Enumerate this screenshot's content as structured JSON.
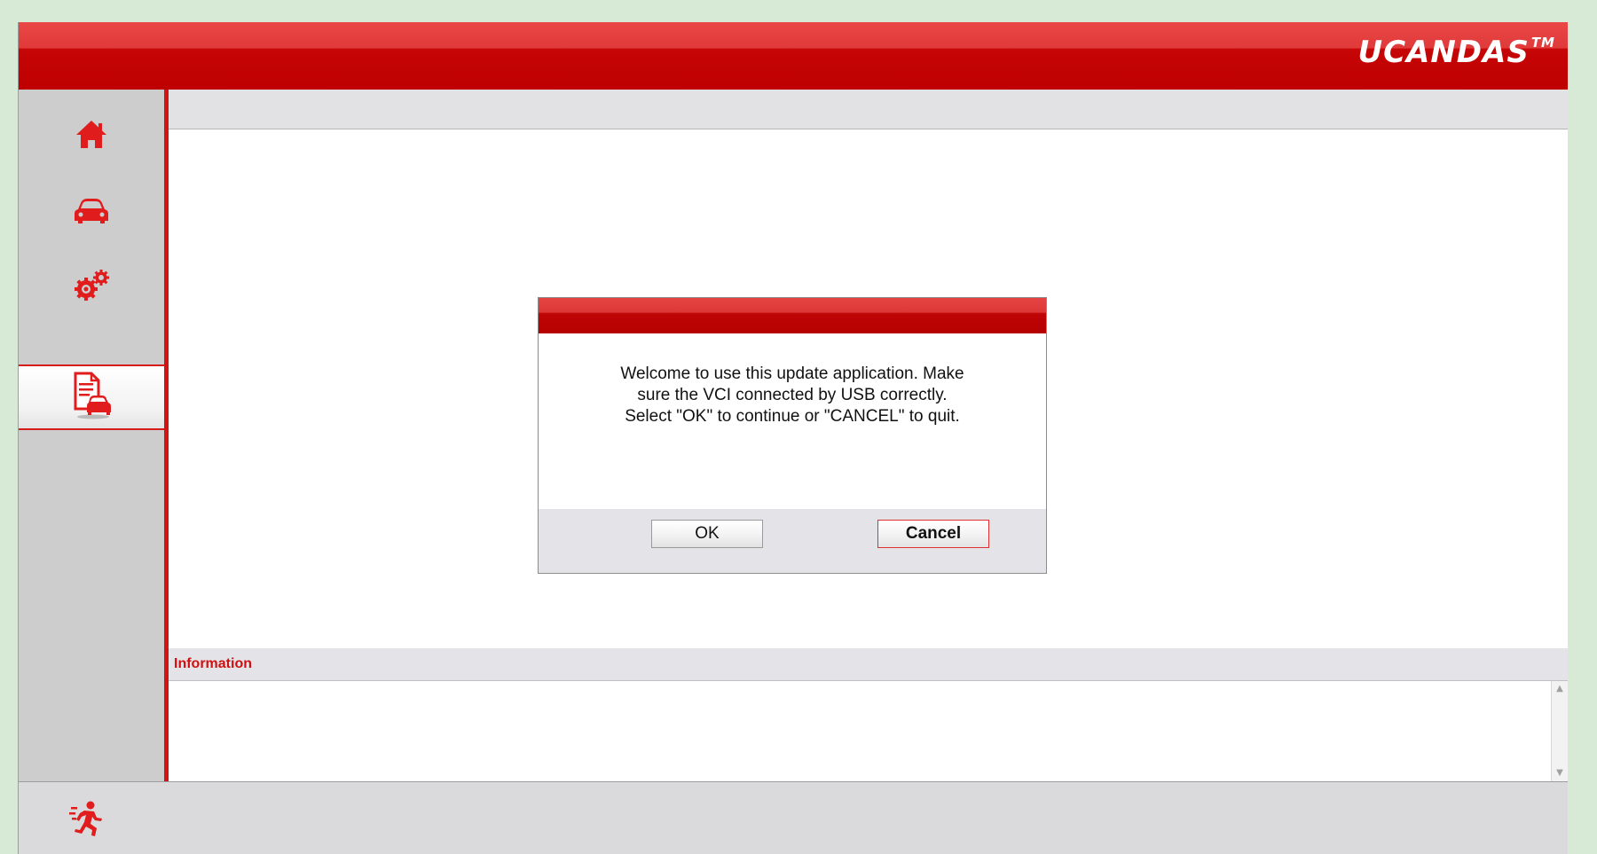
{
  "header": {
    "logo": "UCANDAS",
    "logo_tm": "TM"
  },
  "sidebar": {
    "items": [
      {
        "name": "home",
        "icon": "home-icon",
        "active": false
      },
      {
        "name": "vehicle",
        "icon": "car-icon",
        "active": false
      },
      {
        "name": "settings",
        "icon": "gears-icon",
        "active": false
      },
      {
        "name": "update",
        "icon": "document-car-icon",
        "active": true
      }
    ]
  },
  "info": {
    "label": "Information"
  },
  "dialog": {
    "lines": [
      "Welcome to use this update application. Make",
      "sure the VCI connected by USB correctly.",
      "Select \"OK\" to continue or \"CANCEL\" to quit."
    ],
    "ok_label": "OK",
    "cancel_label": "Cancel"
  },
  "footer": {
    "exit_icon": "exit-running-man-icon"
  },
  "colors": {
    "accent": "#d11414",
    "background": "#d6ead6"
  }
}
